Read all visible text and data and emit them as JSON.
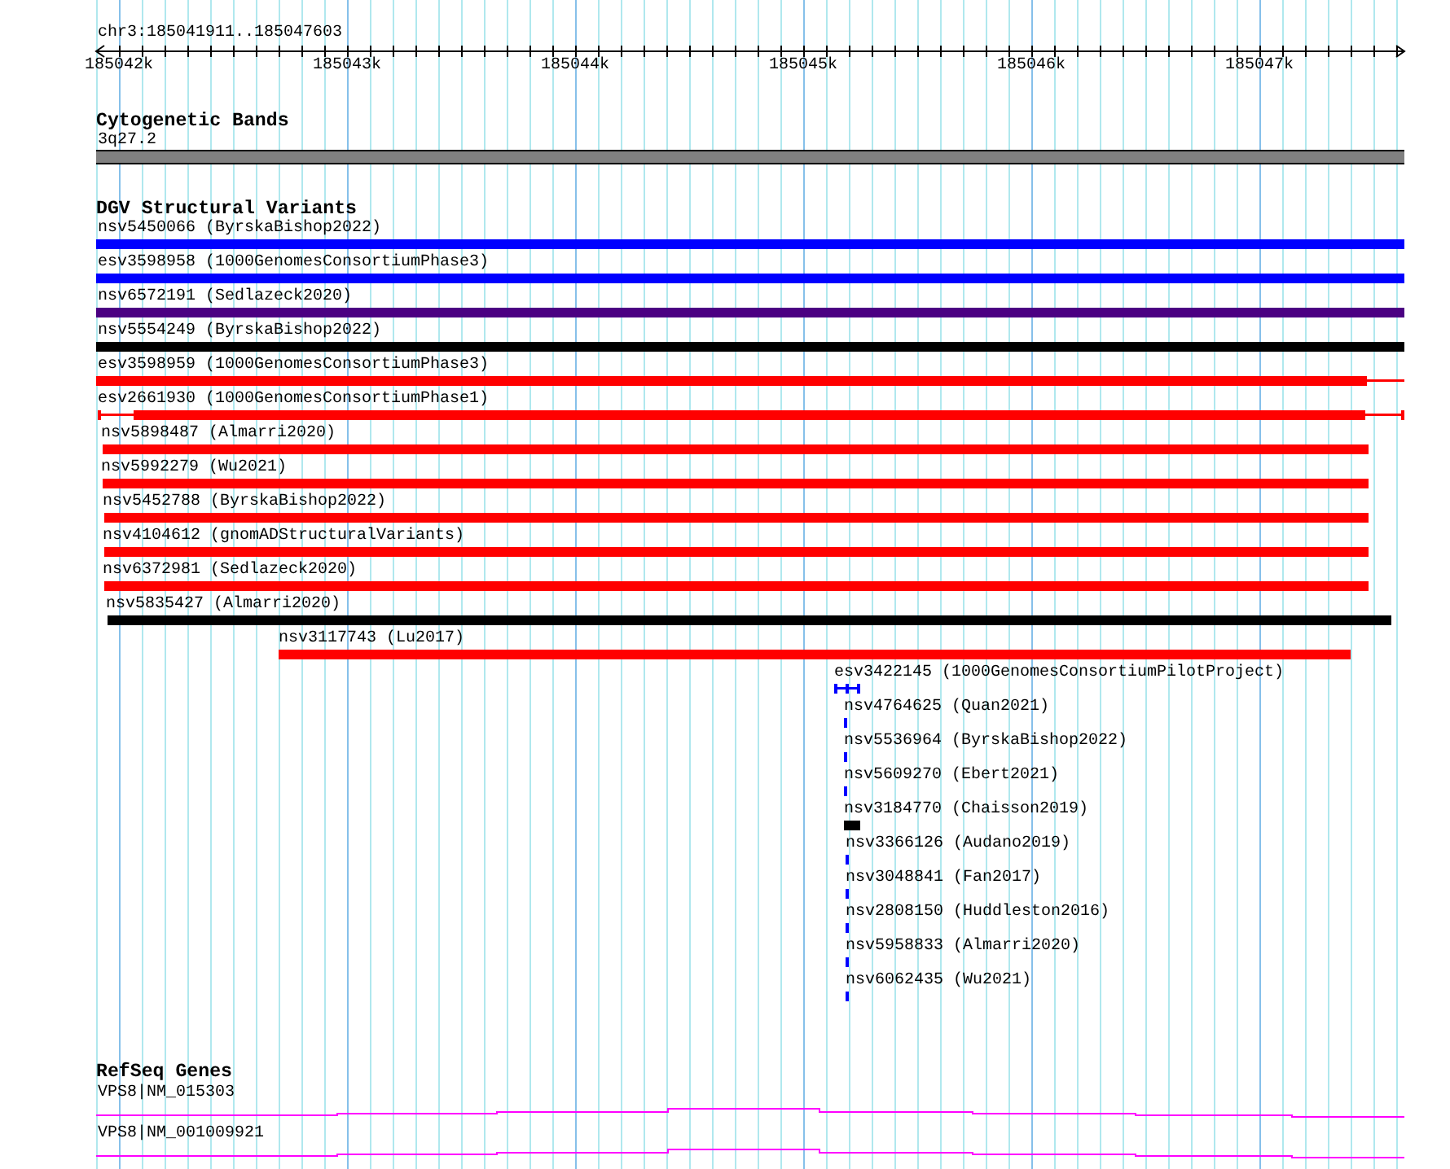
{
  "ruler": {
    "location": "chr3:185041911..185047603",
    "ticks": [
      "185042k",
      "185043k",
      "185044k",
      "185045k",
      "185046k",
      "185047k"
    ]
  },
  "tracks": [
    {
      "title": "Cytogenetic Bands",
      "kind": "bands",
      "features": [
        {
          "label": "3q27.2"
        }
      ]
    },
    {
      "title": "DGV Structural Variants",
      "kind": "variants",
      "features": [
        {
          "label": "nsv5450066 (ByrskaBishop2022)",
          "color": "#0000ff"
        },
        {
          "label": "esv3598958 (1000GenomesConsortiumPhase3)",
          "color": "#0000ff"
        },
        {
          "label": "nsv6572191 (Sedlazeck2020)",
          "color": "#4b0082"
        },
        {
          "label": "nsv5554249 (ByrskaBishop2022)",
          "color": "#000000"
        },
        {
          "label": "esv3598959 (1000GenomesConsortiumPhase3)",
          "color": "#ff0000"
        },
        {
          "label": "esv2661930 (1000GenomesConsortiumPhase1)",
          "color": "#ff0000"
        },
        {
          "label": "nsv5898487 (Almarri2020)",
          "color": "#ff0000"
        },
        {
          "label": "nsv5992279 (Wu2021)",
          "color": "#ff0000"
        },
        {
          "label": "nsv5452788 (ByrskaBishop2022)",
          "color": "#ff0000"
        },
        {
          "label": "nsv4104612 (gnomADStructuralVariants)",
          "color": "#ff0000"
        },
        {
          "label": "nsv6372981 (Sedlazeck2020)",
          "color": "#ff0000"
        },
        {
          "label": "nsv5835427 (Almarri2020)",
          "color": "#000000"
        },
        {
          "label": "nsv3117743 (Lu2017)",
          "color": "#ff0000"
        },
        {
          "label": "esv3422145 (1000GenomesConsortiumPilotProject)",
          "color": "#0000ff"
        },
        {
          "label": "nsv4764625 (Quan2021)",
          "color": "#0000ff"
        },
        {
          "label": "nsv5536964 (ByrskaBishop2022)",
          "color": "#0000ff"
        },
        {
          "label": "nsv5609270 (Ebert2021)",
          "color": "#0000ff"
        },
        {
          "label": "nsv3184770 (Chaisson2019)",
          "color": "#000000"
        },
        {
          "label": "nsv3366126 (Audano2019)",
          "color": "#0000ff"
        },
        {
          "label": "nsv3048841 (Fan2017)",
          "color": "#0000ff"
        },
        {
          "label": "nsv2808150 (Huddleston2016)",
          "color": "#0000ff"
        },
        {
          "label": "nsv5958833 (Almarri2020)",
          "color": "#0000ff"
        },
        {
          "label": "nsv6062435 (Wu2021)",
          "color": "#0000ff"
        }
      ]
    },
    {
      "title": "RefSeq Genes",
      "kind": "genes",
      "features": [
        {
          "label": "VPS8|NM_015303"
        },
        {
          "label": "VPS8|NM_001009921"
        }
      ]
    }
  ]
}
